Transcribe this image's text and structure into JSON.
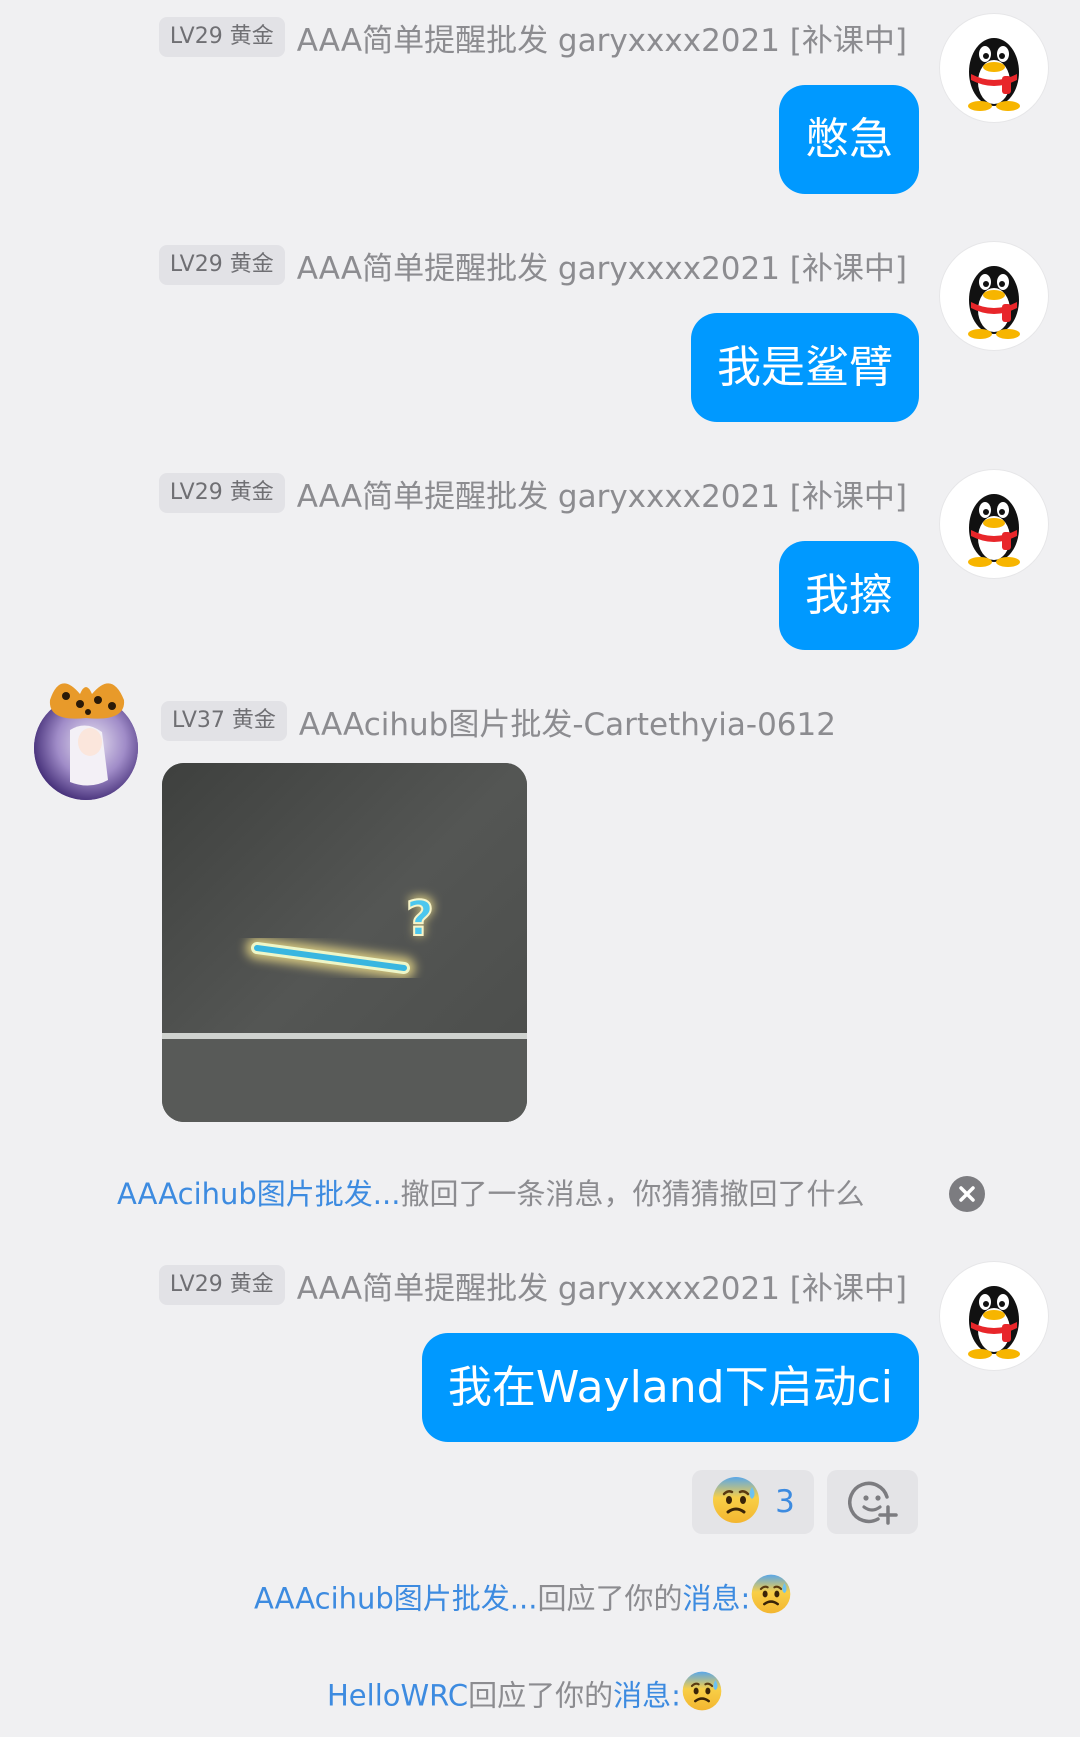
{
  "colors": {
    "bubble": "#0099ff",
    "background": "#f0f0f2",
    "link": "#3d8be0",
    "meta_text": "#8c8c90",
    "badge_bg": "#e2e2e6"
  },
  "messages": [
    {
      "badge": "LV29 黄金",
      "sender": "AAA简单提醒批发 garyxxxx2021 [补课中]",
      "text": "憋急",
      "avatar_icon": "qq-penguin-icon"
    },
    {
      "badge": "LV29 黄金",
      "sender": "AAA简单提醒批发 garyxxxx2021 [补课中]",
      "text": "我是鲨臂",
      "avatar_icon": "qq-penguin-icon"
    },
    {
      "badge": "LV29 黄金",
      "sender": "AAA简单提醒批发 garyxxxx2021 [补课中]",
      "text": "我擦",
      "avatar_icon": "qq-penguin-icon"
    },
    {
      "badge": "LV37 黄金",
      "sender": "AAAcihub图片批发-Cartethyia-0612",
      "image_text": "?",
      "avatar_icon": "anime-girl-avatar-icon"
    },
    {
      "badge": "LV29 黄金",
      "sender": "AAA简单提醒批发 garyxxxx2021 [补课中]",
      "text": "我在Wayland下启动ci",
      "avatar_icon": "qq-penguin-icon"
    }
  ],
  "recall_notice": {
    "name": "AAAcihub图片批发...",
    "text": "撤回了一条消息，你猜猜撤回了什么",
    "close_icon": "close-circle-icon"
  },
  "reactions": {
    "emoji_icon": "anxious-sweat-face-icon",
    "count": "3",
    "add_icon": "add-reaction-icon"
  },
  "notices": [
    {
      "name": "AAAcihub图片批发...",
      "text": "回应了你的",
      "link": "消息:",
      "emoji_icon": "anxious-sweat-face-icon"
    },
    {
      "name": "HelloWRC",
      "text": "回应了你的",
      "link": "消息:",
      "emoji_icon": "anxious-sweat-face-icon"
    }
  ]
}
